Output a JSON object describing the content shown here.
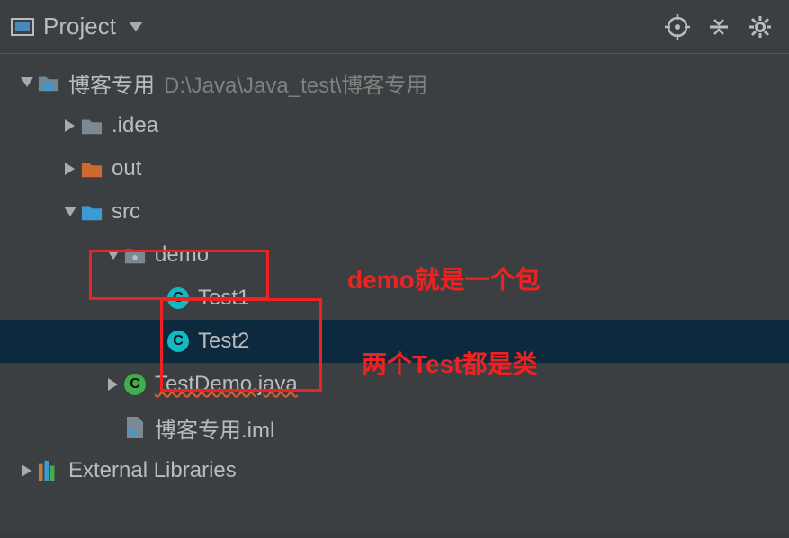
{
  "toolbar": {
    "title": "Project",
    "icons": {
      "target": "target-icon",
      "collapse": "collapse-all-icon",
      "gear": "settings-icon"
    }
  },
  "tree": {
    "root": {
      "name": "博客专用",
      "path": "D:\\Java\\Java_test\\博客专用"
    },
    "idea": ".idea",
    "out": "out",
    "src": "src",
    "demo": "demo",
    "test1": "Test1",
    "test2": "Test2",
    "testdemo": "TestDemo.java",
    "iml": "博客专用.iml",
    "external": "External Libraries"
  },
  "annotations": {
    "demo_note": "demo就是一个包",
    "test_note": "两个Test都是类"
  },
  "class_icon_letter": "C"
}
